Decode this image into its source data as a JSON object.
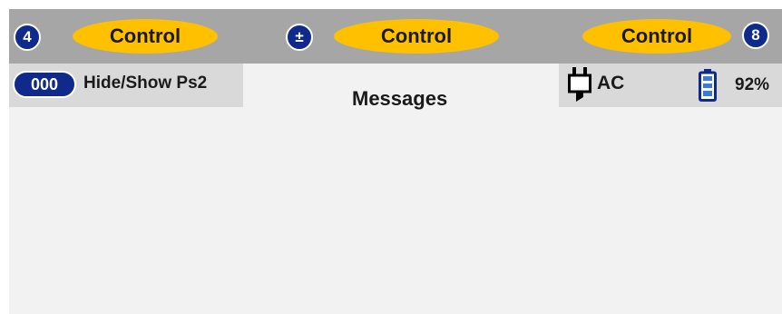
{
  "top_bar": {
    "left_button": "4",
    "center_button": "±",
    "right_button": "8",
    "control_left": "Control",
    "control_center": "Control",
    "control_right": "Control"
  },
  "left_panel": {
    "badge": "000",
    "label": "Hide/Show Ps2"
  },
  "messages": {
    "title": "Messages"
  },
  "status": {
    "power_source": "AC",
    "battery_level": "92%",
    "battery_fraction": 0.92
  },
  "colors": {
    "top_bar": "#a6a6a6",
    "control_pill": "#ffc000",
    "circle_button": "#0f2a8a",
    "panel": "#d9d9d9",
    "screen_bg": "#f2f2f2",
    "battery_fill": "#3a7bd5"
  },
  "icons": [
    "plug-icon",
    "battery-icon"
  ]
}
